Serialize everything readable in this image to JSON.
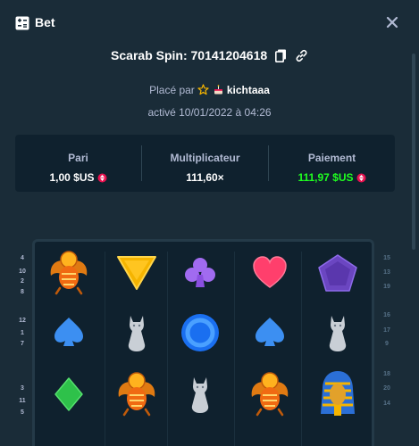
{
  "header": {
    "title": "Bet",
    "icon": "bet-slip-icon",
    "close_icon": "close-icon"
  },
  "game": {
    "title": "Scarab Spin: 70141204618",
    "copy_icon": "copy-icon",
    "link_icon": "link-icon"
  },
  "placed": {
    "prefix": "Placé par",
    "user": "kichtaaa",
    "vip_icon": "star-icon",
    "avatar_icon": "cake-icon"
  },
  "activated": "activé 10/01/2022 à 04:26",
  "stats": {
    "bet": {
      "label": "Pari",
      "value": "1,00 $US",
      "currency_icon": "coin-icon"
    },
    "multiplier": {
      "label": "Multiplicateur",
      "value": "111,60×"
    },
    "payout": {
      "label": "Paiement",
      "value": "111,97 $US",
      "currency_icon": "coin-icon"
    }
  },
  "colors": {
    "background": "#1a2c38",
    "panel": "#0f212e",
    "payout_green": "#1fff20",
    "accent_red": "#e8114f"
  },
  "paylines_left": [
    "4",
    "10",
    "2",
    "8",
    "12",
    "1",
    "7",
    "3",
    "11",
    "5"
  ],
  "paylines_right": [
    "15",
    "13",
    "19",
    "16",
    "17",
    "9",
    "18",
    "20",
    "14"
  ],
  "reels": [
    [
      "scarab",
      "spade",
      "diamond"
    ],
    [
      "triangle",
      "cat",
      "scarab"
    ],
    [
      "club",
      "ring",
      "cat"
    ],
    [
      "heart",
      "spade",
      "scarab"
    ],
    [
      "pentagon",
      "cat",
      "pharaoh"
    ]
  ]
}
